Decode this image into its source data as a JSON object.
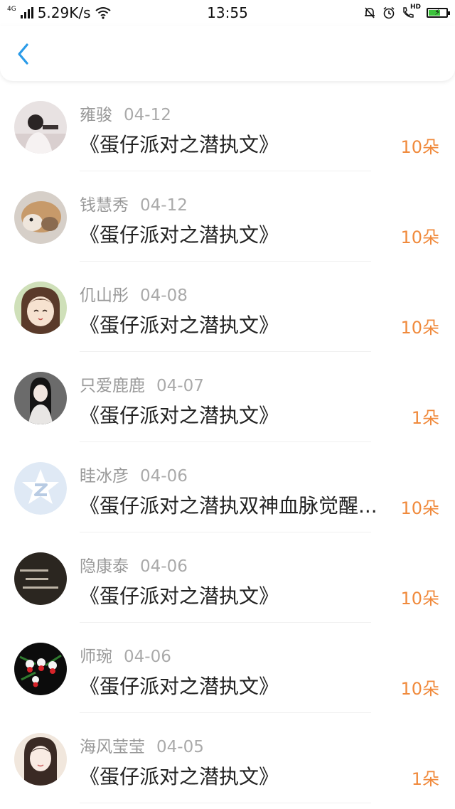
{
  "status_bar": {
    "network": "4G",
    "speed": "5.29K/s",
    "time": "13:55",
    "hd_label": "HD",
    "icons": [
      "signal-icon",
      "wifi-icon",
      "mute-bell-icon",
      "alarm-icon",
      "hd-call-icon",
      "battery-charging-icon"
    ]
  },
  "nav": {
    "back_icon": "chevron-left-icon"
  },
  "colors": {
    "accent": "#2a9be8",
    "gift": "#f08a3c",
    "meta": "#999999"
  },
  "items": [
    {
      "user": "雍骏",
      "date": "04-12",
      "book": "《蛋仔派对之潜执文》",
      "gift": "10朵"
    },
    {
      "user": "钱慧秀",
      "date": "04-12",
      "book": "《蛋仔派对之潜执文》",
      "gift": "10朵"
    },
    {
      "user": "仉山彤",
      "date": "04-08",
      "book": "《蛋仔派对之潜执文》",
      "gift": "10朵"
    },
    {
      "user": "只爱鹿鹿",
      "date": "04-07",
      "book": "《蛋仔派对之潜执文》",
      "gift": "1朵"
    },
    {
      "user": "眭冰彦",
      "date": "04-06",
      "book": "《蛋仔派对之潜执双神血脉觉醒...",
      "gift": "10朵"
    },
    {
      "user": "隐康泰",
      "date": "04-06",
      "book": "《蛋仔派对之潜执文》",
      "gift": "10朵"
    },
    {
      "user": "师琬",
      "date": "04-06",
      "book": "《蛋仔派对之潜执文》",
      "gift": "10朵"
    },
    {
      "user": "海风莹莹",
      "date": "04-05",
      "book": "《蛋仔派对之潜执文》",
      "gift": "1朵"
    }
  ]
}
